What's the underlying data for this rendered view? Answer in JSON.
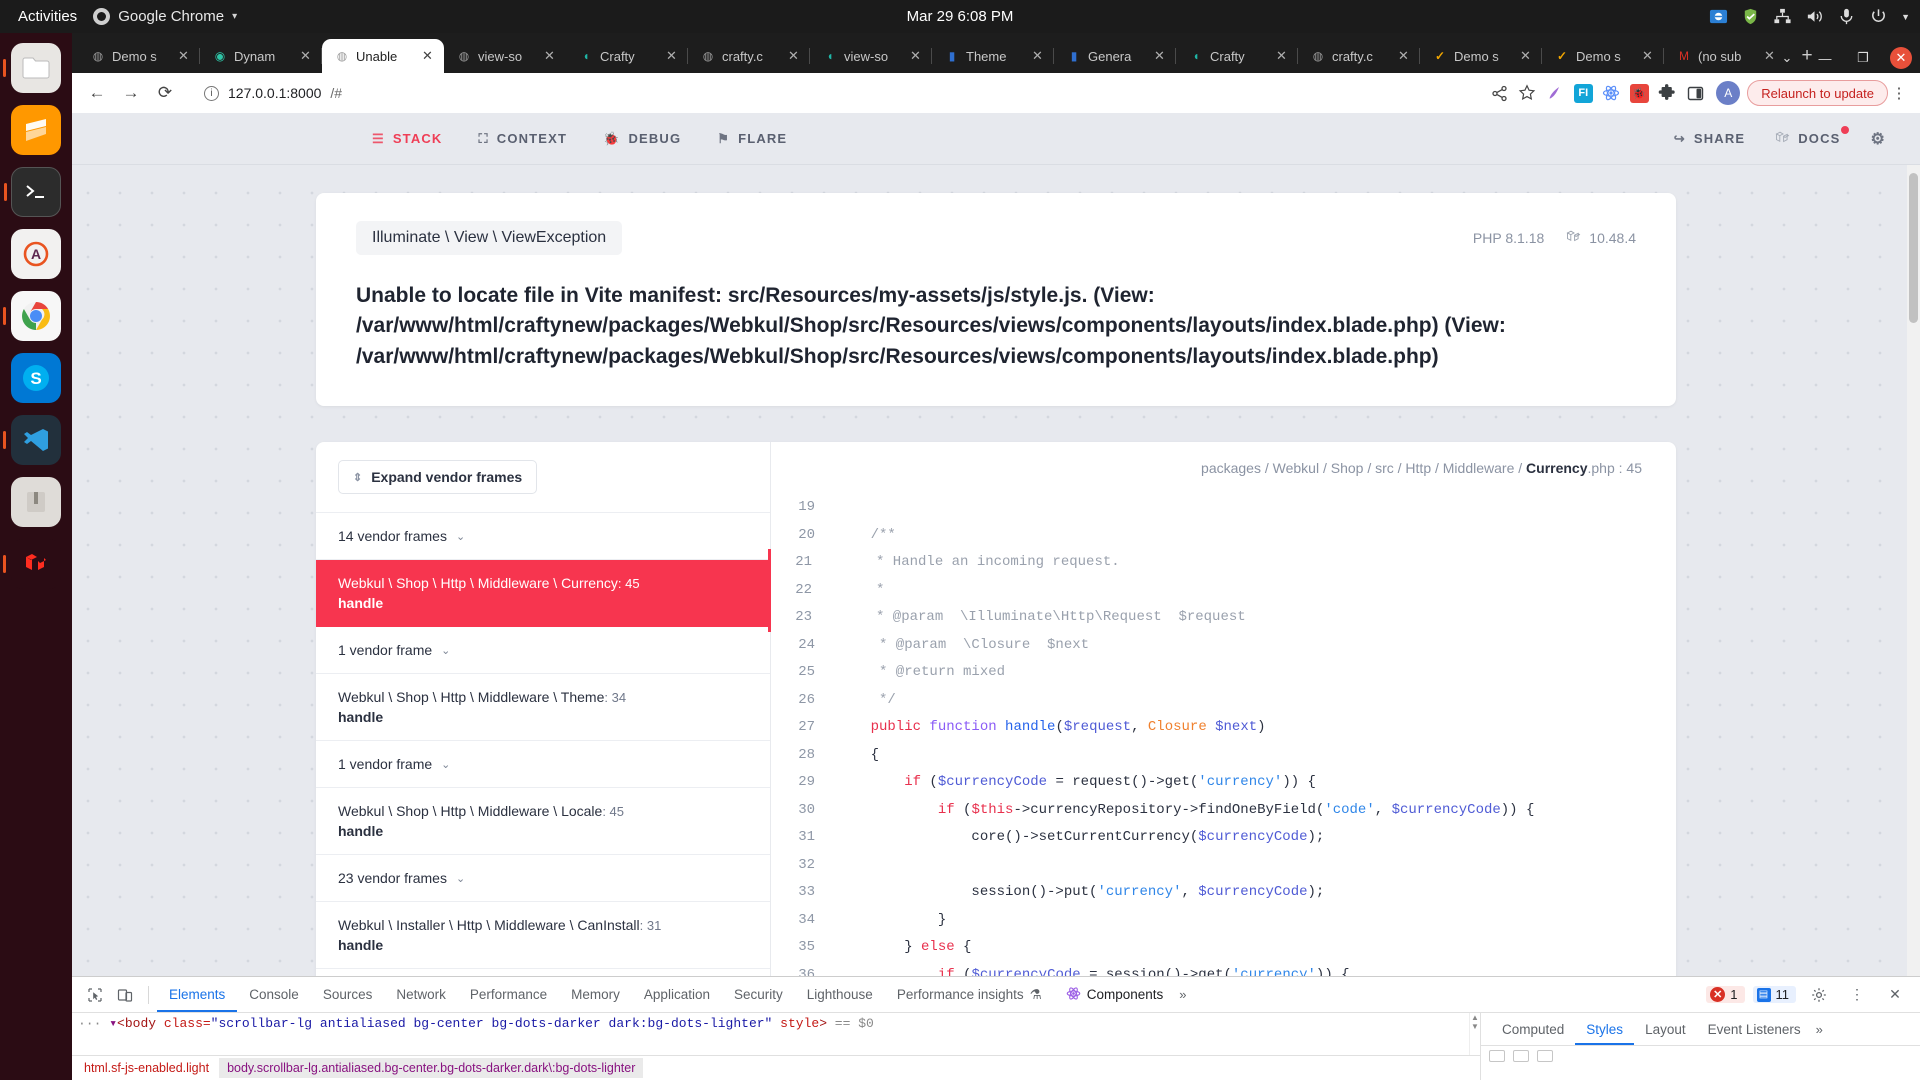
{
  "gnome": {
    "activities": "Activities",
    "app_menu": "Google Chrome",
    "caret": "▾",
    "clock": "Mar 29  6:08 PM",
    "tray_icons": [
      "network-vpn-icon",
      "shield-icon",
      "network-icon",
      "volume-icon",
      "microphone-icon",
      "power-icon",
      "system-caret-icon"
    ]
  },
  "dock": {
    "items": [
      {
        "name": "files",
        "glyph": "🗀"
      },
      {
        "name": "sublime-text",
        "glyph": "S"
      },
      {
        "name": "terminal",
        "glyph": "▸_"
      },
      {
        "name": "ubuntu-software",
        "glyph": "A"
      },
      {
        "name": "google-chrome",
        "glyph": "◉"
      },
      {
        "name": "skype",
        "glyph": "S"
      },
      {
        "name": "visual-studio-code",
        "glyph": "✗"
      },
      {
        "name": "archive-manager",
        "glyph": "🗜"
      },
      {
        "name": "laravel-herd",
        "glyph": "▲"
      }
    ]
  },
  "browser": {
    "tabs": [
      {
        "title": "Demo s",
        "favicon": "globe-icon",
        "close": "✕",
        "active": false
      },
      {
        "title": "Dynam",
        "favicon": "spiral-icon",
        "close": "✕",
        "active": false
      },
      {
        "title": "Unable",
        "favicon": "globe-icon",
        "close": "✕",
        "active": true
      },
      {
        "title": "view-so",
        "favicon": "globe-icon",
        "close": "✕",
        "active": false
      },
      {
        "title": "Crafty",
        "favicon": "crafty-icon",
        "close": "✕",
        "active": false
      },
      {
        "title": "crafty.c",
        "favicon": "globe-icon",
        "close": "✕",
        "active": false
      },
      {
        "title": "view-so",
        "favicon": "crafty-icon",
        "close": "✕",
        "active": false
      },
      {
        "title": "Theme",
        "favicon": "book-icon",
        "close": "✕",
        "active": false
      },
      {
        "title": "Genera",
        "favicon": "book-icon",
        "close": "✕",
        "active": false
      },
      {
        "title": "Crafty",
        "favicon": "crafty-icon",
        "close": "✕",
        "active": false
      },
      {
        "title": "crafty.c",
        "favicon": "globe-icon",
        "close": "✕",
        "active": false
      },
      {
        "title": "Demo s",
        "favicon": "check-icon",
        "close": "✕",
        "active": false
      },
      {
        "title": "Demo s",
        "favicon": "check-icon",
        "close": "✕",
        "active": false
      },
      {
        "title": "(no sub",
        "favicon": "gmail-icon",
        "close": "✕",
        "active": false
      }
    ],
    "new_tab": "+",
    "window_controls": {
      "list": "⌄",
      "minimize": "—",
      "maximize": "❐",
      "close": "✕"
    },
    "nav": {
      "back": "←",
      "forward": "→",
      "reload": "⟳"
    },
    "address": {
      "info_icon": "ⓘ",
      "host": "127.0.0.1:8000",
      "path": "/#",
      "full": "127.0.0.1:8000/#"
    },
    "toolbar_icons": [
      {
        "name": "share-icon",
        "glyph": "⤳"
      },
      {
        "name": "bookmark-star-icon",
        "glyph": "☆"
      },
      {
        "name": "grammarly-extension-icon",
        "glyph": "✎"
      },
      {
        "name": "fi-extension-icon",
        "glyph": "FI"
      },
      {
        "name": "react-devtools-icon",
        "glyph": "✳"
      },
      {
        "name": "debugbar-extension-icon",
        "glyph": "🐞"
      },
      {
        "name": "extensions-puzzle-icon",
        "glyph": "🧩"
      },
      {
        "name": "sidepanel-icon",
        "glyph": "▢"
      }
    ],
    "avatar_letter": "A",
    "relaunch_label": "Relaunch to update",
    "kebab": "⋮"
  },
  "ignition": {
    "nav_left": [
      {
        "label": "STACK",
        "icon": "stack-icon",
        "glyph": "☰",
        "active": true
      },
      {
        "label": "CONTEXT",
        "icon": "context-icon",
        "glyph": "⛶",
        "active": false
      },
      {
        "label": "DEBUG",
        "icon": "debug-icon",
        "glyph": "🐞",
        "active": false
      },
      {
        "label": "FLARE",
        "icon": "flare-icon",
        "glyph": "⚑",
        "active": false
      }
    ],
    "nav_right": [
      {
        "label": "SHARE",
        "icon": "share-arrow-icon",
        "glyph": "↪",
        "badge": false
      },
      {
        "label": "DOCS",
        "icon": "laravel-icon",
        "glyph": "⩕",
        "badge": true
      }
    ],
    "settings_icon": "gear-icon",
    "exception": {
      "class": "Illuminate \\ View \\ ViewException",
      "php_version": "PHP 8.1.18",
      "laravel_version": "10.48.4",
      "message": "Unable to locate file in Vite manifest: src/Resources/my-assets/js/style.js. (View: /var/www/html/craftynew/packages/Webkul/Shop/src/Resources/views/components/layouts/index.blade.php) (View: /var/www/html/craftynew/packages/Webkul/Shop/src/Resources/views/components/layouts/index.blade.php)"
    },
    "expand_vendor_label": "Expand vendor frames",
    "expand_icon": "sort-updown-icon",
    "frames": [
      {
        "type": "vendor",
        "label": "14 vendor frames",
        "chevron": "⌄"
      },
      {
        "type": "app",
        "cls": "Webkul \\ Shop \\ Http \\ Middleware \\ Currency",
        "line": ": 45",
        "method": "handle",
        "selected": true
      },
      {
        "type": "vendor",
        "label": "1 vendor frame",
        "chevron": "⌄"
      },
      {
        "type": "app",
        "cls": "Webkul \\ Shop \\ Http \\ Middleware \\ Theme",
        "line": ": 34",
        "method": "handle",
        "selected": false
      },
      {
        "type": "vendor",
        "label": "1 vendor frame",
        "chevron": "⌄"
      },
      {
        "type": "app",
        "cls": "Webkul \\ Shop \\ Http \\ Middleware \\ Locale",
        "line": ": 45",
        "method": "handle",
        "selected": false
      },
      {
        "type": "vendor",
        "label": "23 vendor frames",
        "chevron": "⌄"
      },
      {
        "type": "app",
        "cls": "Webkul \\ Installer \\ Http \\ Middleware \\ CanInstall",
        "line": ": 31",
        "method": "handle",
        "selected": false
      }
    ],
    "code_path": "packages / Webkul / Shop / src / Http / Middleware / ",
    "code_file": "Currency",
    "code_ext": ".php",
    "code_line_ref": " : 45",
    "code": [
      {
        "n": "19",
        "hl": false,
        "tokens": [
          {
            "t": "",
            "c": ""
          }
        ]
      },
      {
        "n": "20",
        "hl": false,
        "tokens": [
          {
            "t": "    /**",
            "c": "t-com"
          }
        ]
      },
      {
        "n": "21",
        "hl": true,
        "tokens": [
          {
            "t": "     * Handle an incoming request.",
            "c": "t-com"
          }
        ]
      },
      {
        "n": "22",
        "hl": true,
        "tokens": [
          {
            "t": "     *",
            "c": "t-com"
          }
        ]
      },
      {
        "n": "23",
        "hl": true,
        "tokens": [
          {
            "t": "     * @param  \\Illuminate\\Http\\Request  $request",
            "c": "t-com"
          }
        ]
      },
      {
        "n": "24",
        "hl": false,
        "tokens": [
          {
            "t": "     * @param  \\Closure  $next",
            "c": "t-com"
          }
        ]
      },
      {
        "n": "25",
        "hl": false,
        "tokens": [
          {
            "t": "     * @return mixed",
            "c": "t-com"
          }
        ]
      },
      {
        "n": "26",
        "hl": false,
        "tokens": [
          {
            "t": "     */",
            "c": "t-com"
          }
        ]
      },
      {
        "n": "27",
        "hl": false,
        "tokens": [
          {
            "t": "    public",
            "c": "t-kw"
          },
          {
            "t": " ",
            "c": ""
          },
          {
            "t": "function",
            "c": "t-kw2"
          },
          {
            "t": " ",
            "c": ""
          },
          {
            "t": "handle",
            "c": "t-fn"
          },
          {
            "t": "(",
            "c": ""
          },
          {
            "t": "$request",
            "c": "t-var"
          },
          {
            "t": ", ",
            "c": ""
          },
          {
            "t": "Closure",
            "c": "t-cls"
          },
          {
            "t": " ",
            "c": ""
          },
          {
            "t": "$next",
            "c": "t-var"
          },
          {
            "t": ")",
            "c": ""
          }
        ]
      },
      {
        "n": "28",
        "hl": false,
        "tokens": [
          {
            "t": "    {",
            "c": ""
          }
        ]
      },
      {
        "n": "29",
        "hl": false,
        "tokens": [
          {
            "t": "        ",
            "c": ""
          },
          {
            "t": "if",
            "c": "t-kw"
          },
          {
            "t": " (",
            "c": ""
          },
          {
            "t": "$currencyCode",
            "c": "t-var"
          },
          {
            "t": " = request()->get(",
            "c": ""
          },
          {
            "t": "'currency'",
            "c": "t-str"
          },
          {
            "t": ")) {",
            "c": ""
          }
        ]
      },
      {
        "n": "30",
        "hl": false,
        "tokens": [
          {
            "t": "            ",
            "c": ""
          },
          {
            "t": "if",
            "c": "t-kw"
          },
          {
            "t": " (",
            "c": ""
          },
          {
            "t": "$this",
            "c": "t-kw"
          },
          {
            "t": "->currencyRepository->findOneByField(",
            "c": ""
          },
          {
            "t": "'code'",
            "c": "t-str"
          },
          {
            "t": ", ",
            "c": ""
          },
          {
            "t": "$currencyCode",
            "c": "t-var"
          },
          {
            "t": ")) {",
            "c": ""
          }
        ]
      },
      {
        "n": "31",
        "hl": false,
        "tokens": [
          {
            "t": "                core()->setCurrentCurrency(",
            "c": ""
          },
          {
            "t": "$currencyCode",
            "c": "t-var"
          },
          {
            "t": ");",
            "c": ""
          }
        ]
      },
      {
        "n": "32",
        "hl": false,
        "tokens": [
          {
            "t": "",
            "c": ""
          }
        ]
      },
      {
        "n": "33",
        "hl": false,
        "tokens": [
          {
            "t": "                session()->put(",
            "c": ""
          },
          {
            "t": "'currency'",
            "c": "t-str"
          },
          {
            "t": ", ",
            "c": ""
          },
          {
            "t": "$currencyCode",
            "c": "t-var"
          },
          {
            "t": ");",
            "c": ""
          }
        ]
      },
      {
        "n": "34",
        "hl": false,
        "tokens": [
          {
            "t": "            }",
            "c": ""
          }
        ]
      },
      {
        "n": "35",
        "hl": false,
        "tokens": [
          {
            "t": "        } ",
            "c": ""
          },
          {
            "t": "else",
            "c": "t-kw"
          },
          {
            "t": " {",
            "c": ""
          }
        ]
      },
      {
        "n": "36",
        "hl": false,
        "tokens": [
          {
            "t": "            ",
            "c": ""
          },
          {
            "t": "if",
            "c": "t-kw"
          },
          {
            "t": " (",
            "c": ""
          },
          {
            "t": "$currencyCode",
            "c": "t-var"
          },
          {
            "t": " = session()->get(",
            "c": ""
          },
          {
            "t": "'currency'",
            "c": "t-str"
          },
          {
            "t": ")) {",
            "c": ""
          }
        ]
      }
    ]
  },
  "devtools": {
    "tool_icons": [
      {
        "name": "inspect-element-icon",
        "glyph": "⬔"
      },
      {
        "name": "device-toolbar-icon",
        "glyph": "❐"
      }
    ],
    "tabs": [
      {
        "label": "Elements",
        "active": true
      },
      {
        "label": "Console",
        "active": false
      },
      {
        "label": "Sources",
        "active": false
      },
      {
        "label": "Network",
        "active": false
      },
      {
        "label": "Performance",
        "active": false
      },
      {
        "label": "Memory",
        "active": false
      },
      {
        "label": "Application",
        "active": false
      },
      {
        "label": "Security",
        "active": false
      },
      {
        "label": "Lighthouse",
        "active": false
      },
      {
        "label": "Performance insights",
        "active": false,
        "suffix": "⚗"
      },
      {
        "label": "Components",
        "active": false,
        "icon": "react-atom-icon"
      }
    ],
    "overflow_chevron": "»",
    "error_count": "1",
    "message_count": "11",
    "settings_icon": "gear-icon",
    "more_icon": "⋮",
    "close_icon": "✕",
    "dom": {
      "prefix": "···",
      "triangle": "▾",
      "open": "<body",
      "attr_name": " class=",
      "attr_value": "\"scrollbar-lg antialiased bg-center bg-dots-darker dark:bg-dots-lighter\"",
      "attr2_name": " style",
      "close": ">",
      "suffix": " == $0"
    },
    "breadcrumbs": [
      {
        "label": "html.sf-js-enabled.light",
        "active": false
      },
      {
        "label": "body.scrollbar-lg.antialiased.bg-center.bg-dots-darker.dark\\:bg-dots-lighter",
        "active": true
      }
    ],
    "style_tabs": [
      {
        "label": "Computed",
        "active": false
      },
      {
        "label": "Styles",
        "active": true
      },
      {
        "label": "Layout",
        "active": false
      },
      {
        "label": "Event Listeners",
        "active": false
      }
    ],
    "style_overflow": "»"
  }
}
